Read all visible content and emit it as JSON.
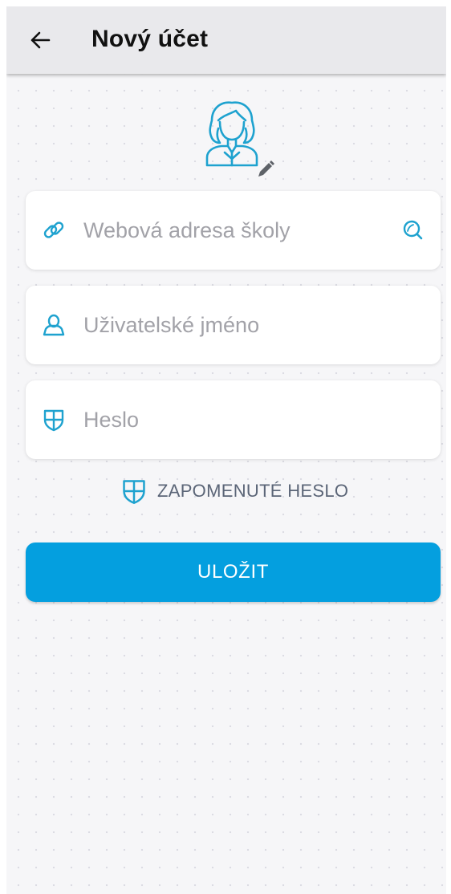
{
  "appbar": {
    "title": "Nový účet",
    "back_icon": "arrow-left-icon"
  },
  "avatar": {
    "icon": "woman-avatar-icon",
    "edit_icon": "pencil-icon"
  },
  "form": {
    "school_url": {
      "placeholder": "Webová adresa školy",
      "icon": "link-icon",
      "action_icon": "search-icon"
    },
    "username": {
      "placeholder": "Uživatelské jméno",
      "icon": "user-icon"
    },
    "password": {
      "placeholder": "Heslo",
      "icon": "shield-icon"
    }
  },
  "forgot_password": {
    "label": "ZAPOMENUTÉ HESLO",
    "icon": "shield-icon"
  },
  "save_button": {
    "label": "ULOŽIT"
  },
  "colors": {
    "accent": "#049fdf",
    "icon": "#1ea2cf",
    "appbar": "#e9e9ec",
    "background": "#f6f6f8"
  }
}
